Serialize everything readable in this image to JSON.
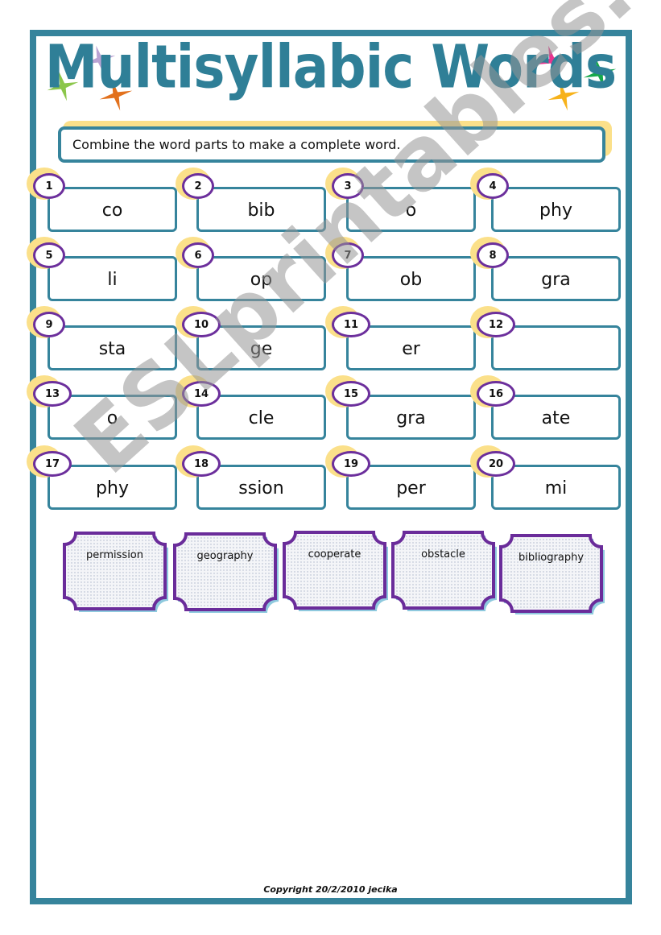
{
  "title": "Multisyllabic Words",
  "instruction": "Combine the word parts to make a complete word.",
  "items": [
    {
      "num": "1",
      "part": "co"
    },
    {
      "num": "2",
      "part": "bib"
    },
    {
      "num": "3",
      "part": "o"
    },
    {
      "num": "4",
      "part": "phy"
    },
    {
      "num": "5",
      "part": "li"
    },
    {
      "num": "6",
      "part": "op"
    },
    {
      "num": "7",
      "part": "ob"
    },
    {
      "num": "8",
      "part": "gra"
    },
    {
      "num": "9",
      "part": "sta"
    },
    {
      "num": "10",
      "part": "ge"
    },
    {
      "num": "11",
      "part": "er"
    },
    {
      "num": "12",
      "part": ""
    },
    {
      "num": "13",
      "part": "o"
    },
    {
      "num": "14",
      "part": "cle"
    },
    {
      "num": "15",
      "part": "gra"
    },
    {
      "num": "16",
      "part": "ate"
    },
    {
      "num": "17",
      "part": "phy"
    },
    {
      "num": "18",
      "part": "ssion"
    },
    {
      "num": "19",
      "part": "per"
    },
    {
      "num": "20",
      "part": "mi"
    }
  ],
  "word_cards": [
    "permission",
    "geography",
    "cooperate",
    "obstacle",
    "bibliography"
  ],
  "watermark": "ESLprintables.com",
  "copyright": "Copyright 20/2/2010  jecika",
  "colors": {
    "frame": "#36849c",
    "title": "#2f7f97",
    "circle_border": "#6c2f9c",
    "glow": "#fbe08a",
    "card_border": "#6a2c9a",
    "card_shadow": "#8ec9de",
    "stars": [
      "#b9a3d3",
      "#8bc64a",
      "#e2711d",
      "#e8358f",
      "#17a84b",
      "#f7b21a"
    ]
  }
}
